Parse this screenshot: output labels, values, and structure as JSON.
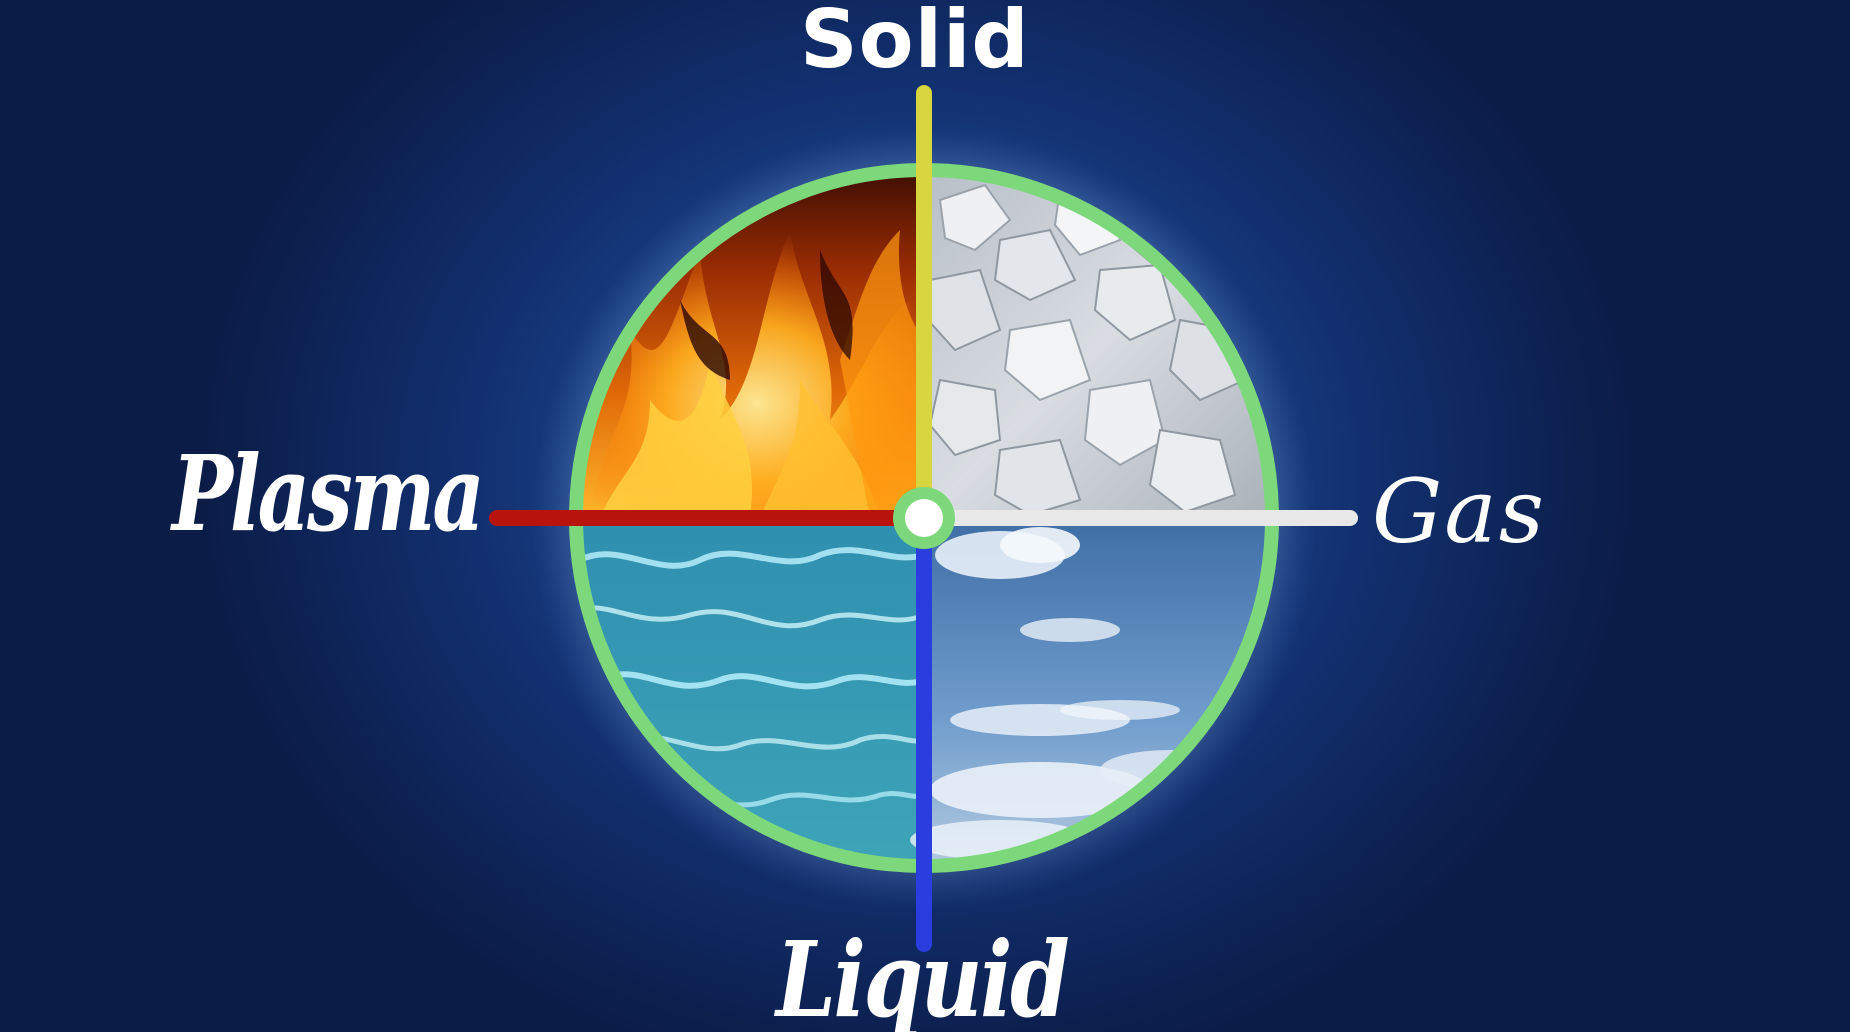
{
  "labels": {
    "top": "Solid",
    "left": "Plasma",
    "right": "Gas",
    "bottom": "Liquid"
  },
  "quadrants": {
    "top_left": "fire",
    "top_right": "crystals",
    "bottom_left": "water",
    "bottom_right": "sky"
  },
  "colors": {
    "background": "#163a7c",
    "ring": "#7cd87a",
    "axis_solid": "#d8d640",
    "axis_plasma": "#b8140c",
    "axis_gas": "#e8e8e8",
    "axis_liquid": "#2a3ee0",
    "center_hub": "#ffffff"
  }
}
